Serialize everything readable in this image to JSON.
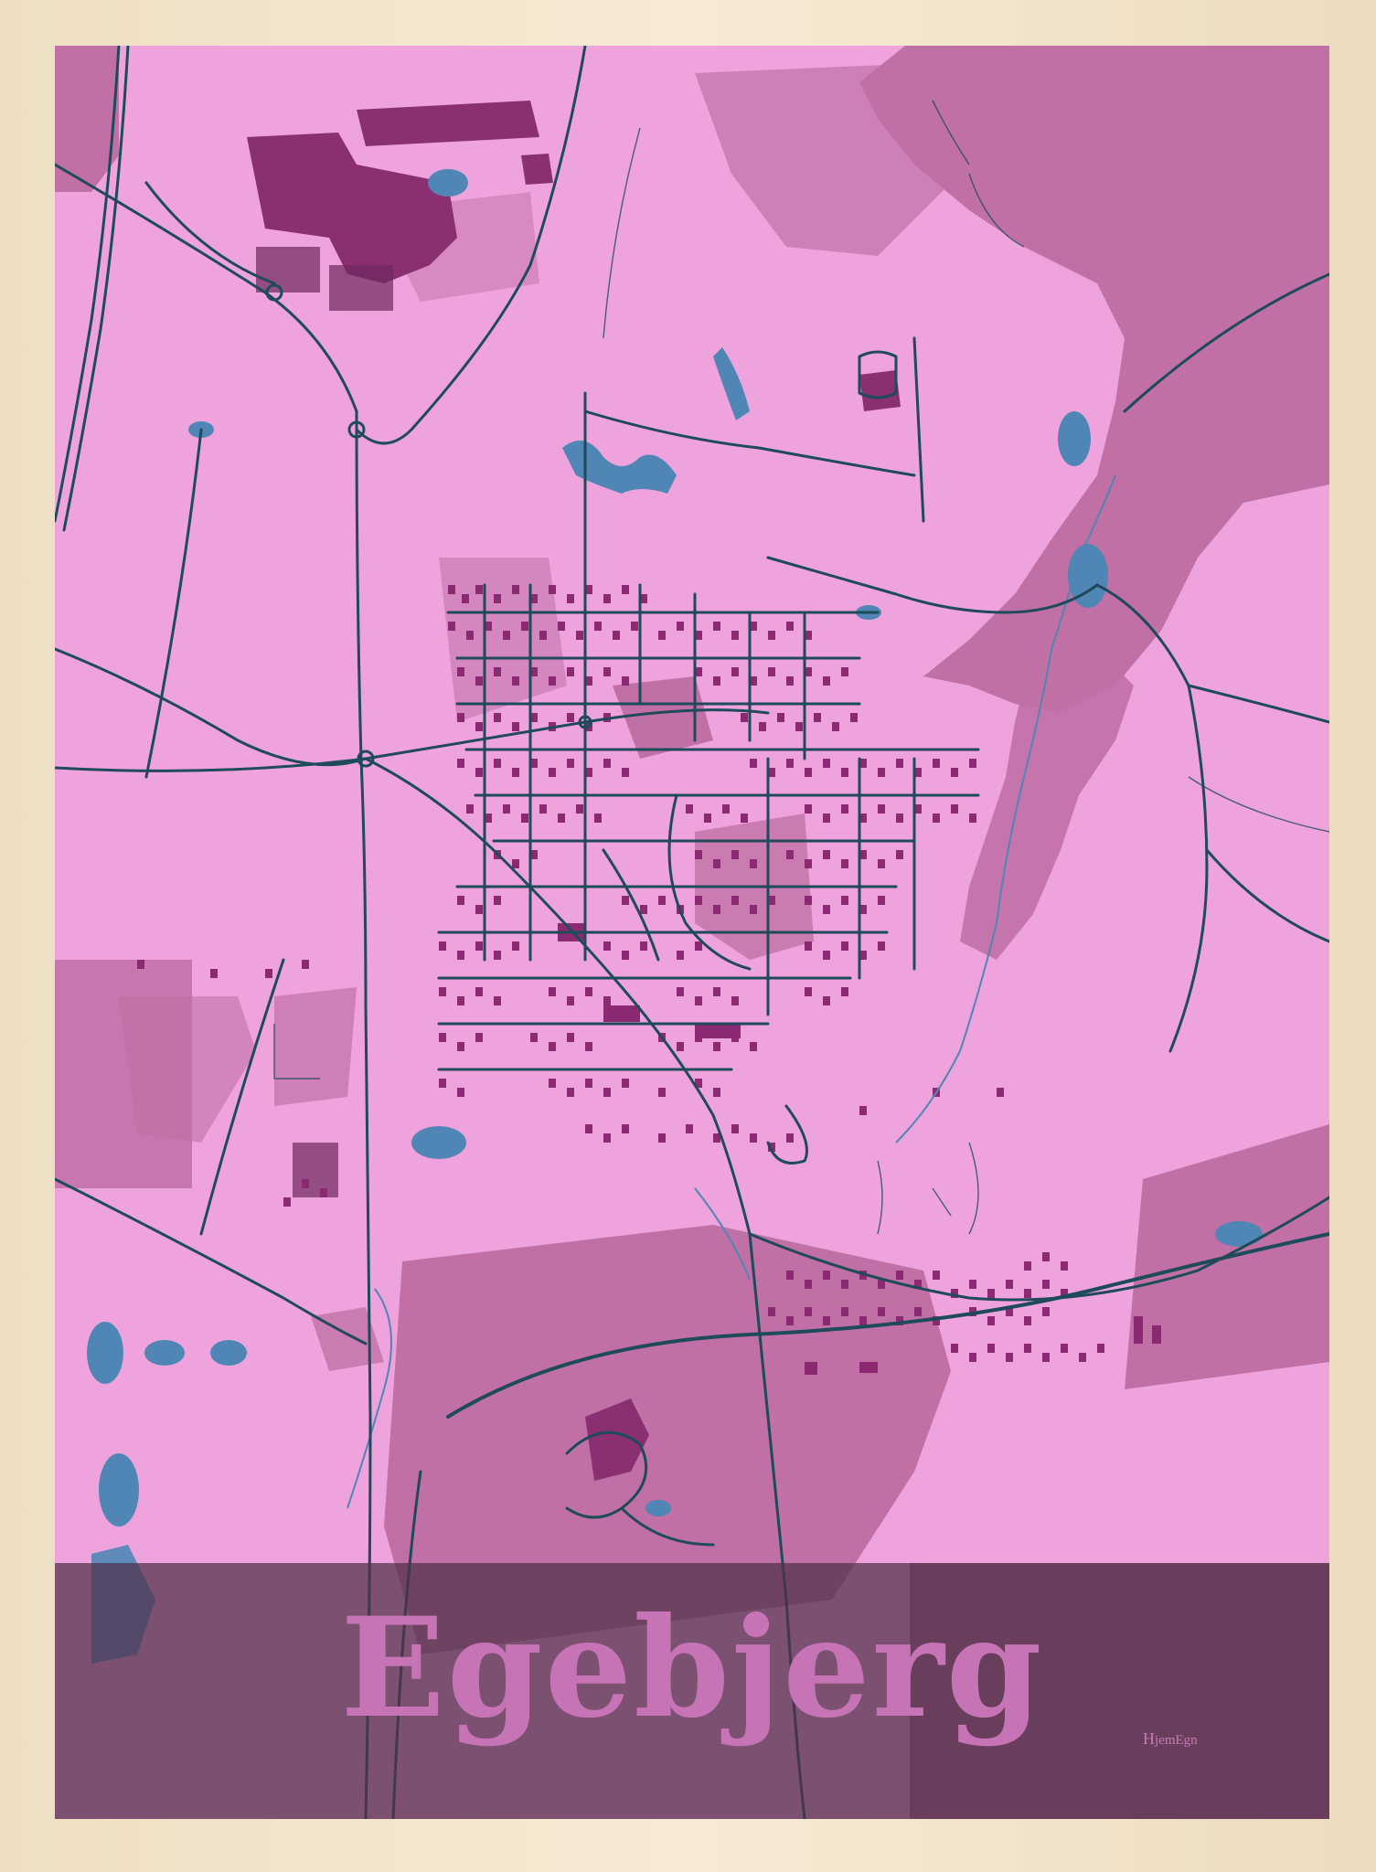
{
  "poster": {
    "city_name": "Egebjerg",
    "brand_initial": "H",
    "brand_rest": "jemEgn"
  },
  "colors": {
    "frame_wood": "#f3e6cf",
    "land": "#eea3dc",
    "farmland": "#c070a5",
    "industrial": "#8a2f72",
    "buildings": "#8b2a72",
    "water": "#4f86b5",
    "roads": "#1e4a59",
    "title_band": "#5f3652",
    "title_text": "#c774b6"
  }
}
